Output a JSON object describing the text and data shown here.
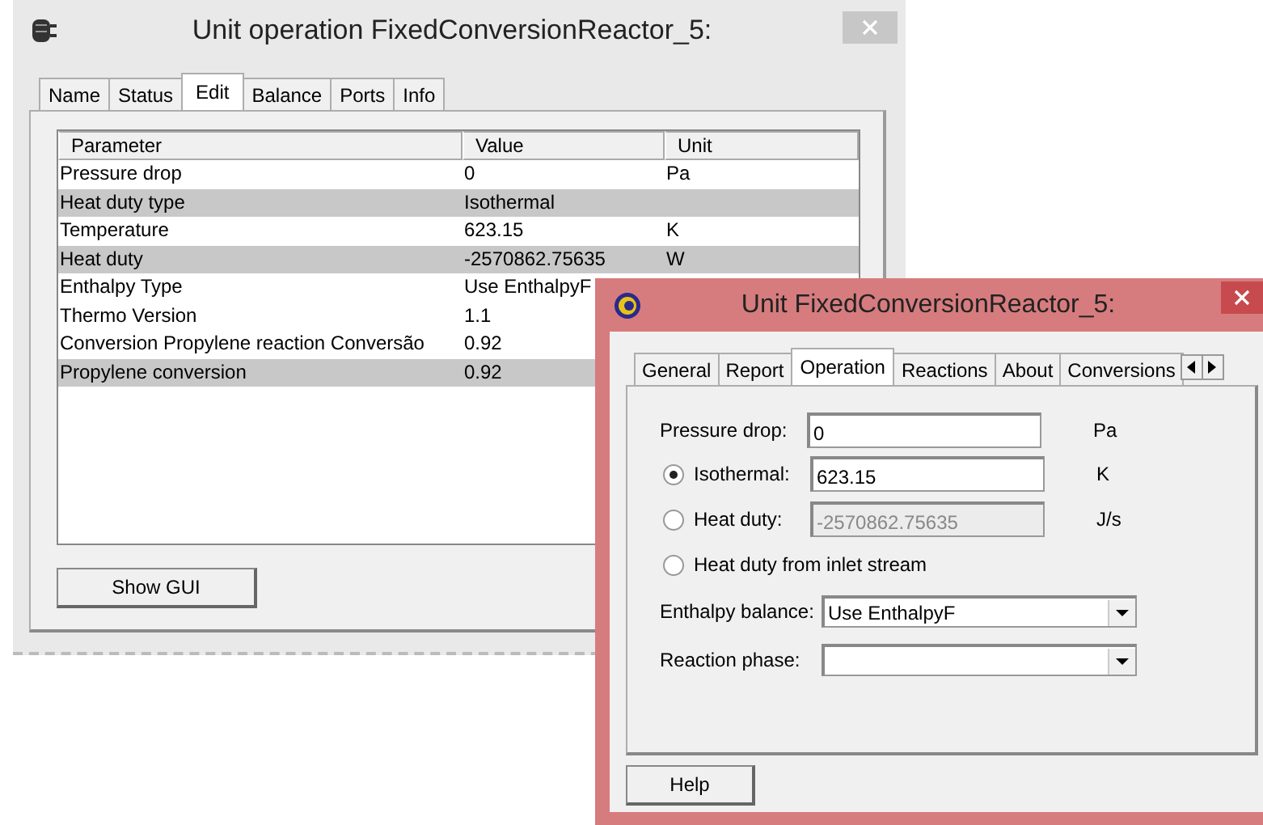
{
  "main_window": {
    "title": "Unit operation FixedConversionReactor_5:",
    "tabs": [
      {
        "label": "Name",
        "selected": false
      },
      {
        "label": "Status",
        "selected": false
      },
      {
        "label": "Edit",
        "selected": true
      },
      {
        "label": "Balance",
        "selected": false
      },
      {
        "label": "Ports",
        "selected": false
      },
      {
        "label": "Info",
        "selected": false
      }
    ],
    "table": {
      "columns": [
        "Parameter",
        "Value",
        "Unit"
      ],
      "rows": [
        {
          "parameter": "Pressure drop",
          "value": "0",
          "unit": "Pa",
          "highlighted": false
        },
        {
          "parameter": "Heat duty type",
          "value": "Isothermal",
          "highlighted": true
        },
        {
          "parameter": "Temperature",
          "value": "623.15",
          "unit": "K",
          "highlighted": false
        },
        {
          "parameter": "Heat duty",
          "value": "-2570862.75635",
          "unit": "W",
          "highlighted": true
        },
        {
          "parameter": "Enthalpy Type",
          "value": "Use EnthalpyF",
          "highlighted": false
        },
        {
          "parameter": "Thermo Version",
          "value": "1.1",
          "highlighted": false
        },
        {
          "parameter": "Conversion Propylene reaction Conversão",
          "value": "0.92",
          "highlighted": false
        },
        {
          "parameter": "Propylene conversion",
          "value": "0.92",
          "highlighted": true
        }
      ]
    },
    "button": "Show GUI"
  },
  "gui_window": {
    "title": "Unit FixedConversionReactor_5:",
    "tabs": [
      {
        "label": "General",
        "selected": false
      },
      {
        "label": "Report",
        "selected": false
      },
      {
        "label": "Operation",
        "selected": true
      },
      {
        "label": "Reactions",
        "selected": false
      },
      {
        "label": "About",
        "selected": false
      },
      {
        "label": "Conversions",
        "selected": false
      }
    ],
    "fields": [
      {
        "kind": "text",
        "label": "Pressure drop:",
        "value": "0",
        "unit": "Pa"
      },
      {
        "kind": "radio",
        "label": "Isothermal:",
        "selected": true,
        "value": "623.15",
        "unit": "K",
        "disabled": false
      },
      {
        "kind": "radio",
        "label": "Heat duty:",
        "selected": false,
        "value": "-2570862.75635",
        "unit": "J/s",
        "disabled": true
      },
      {
        "kind": "radio",
        "label": "Heat duty from inlet stream",
        "selected": false
      },
      {
        "kind": "select",
        "label": "Enthalpy balance:",
        "value": "Use EnthalpyF"
      },
      {
        "kind": "select",
        "label": "Reaction phase:"
      }
    ],
    "button": "Help"
  }
}
